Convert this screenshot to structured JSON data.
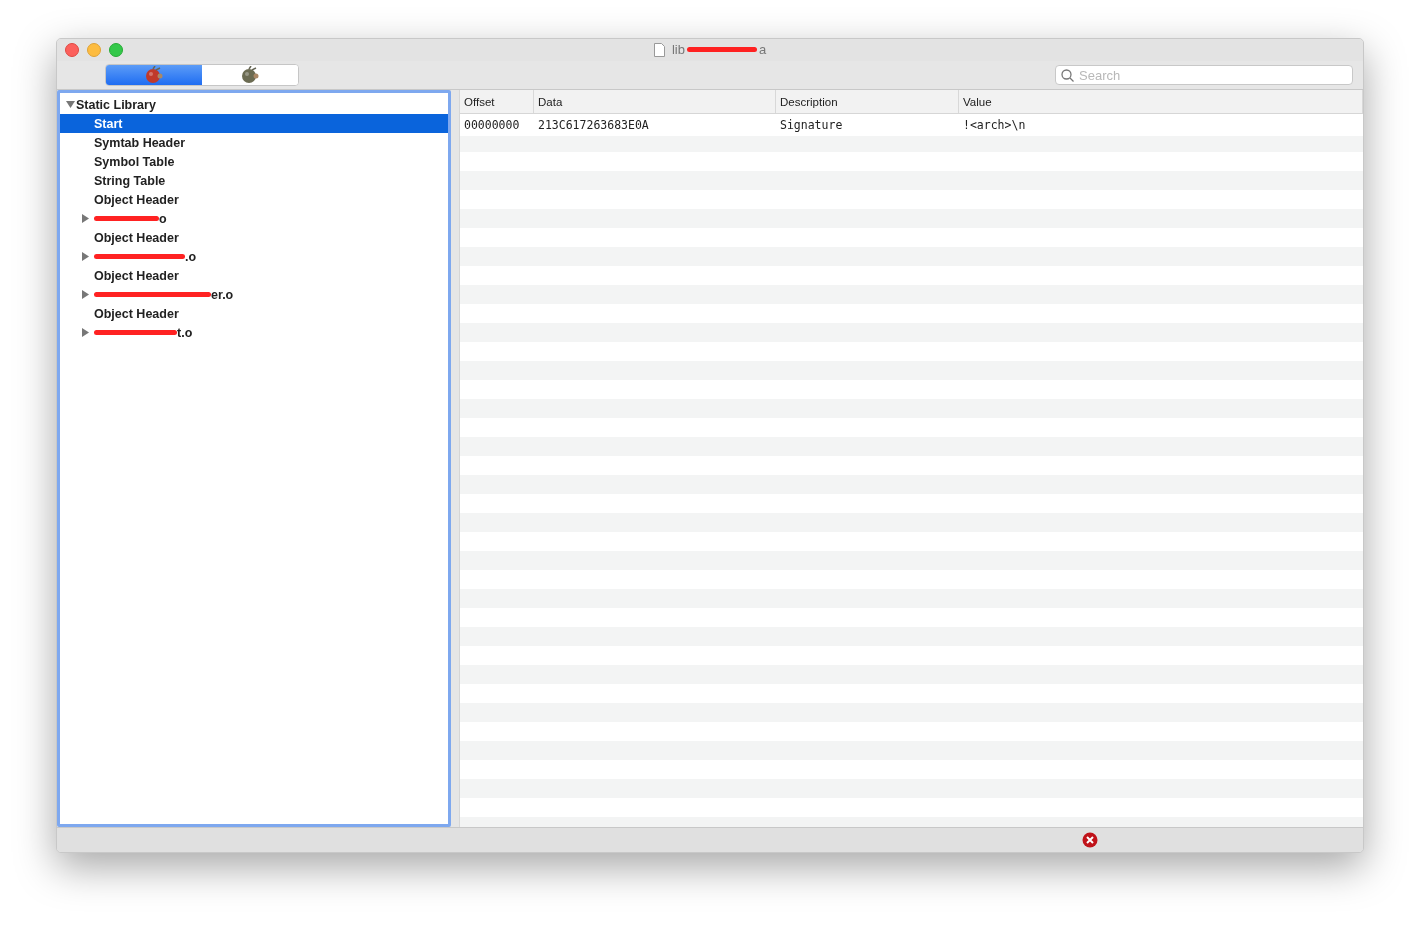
{
  "window": {
    "title_before": "lib",
    "title_after": "a",
    "title_redacted": true
  },
  "view_switch": [
    {
      "selected": true
    },
    {
      "selected": false
    }
  ],
  "search": {
    "placeholder": "Search"
  },
  "tree": [
    {
      "label": "Static Library",
      "expanded": true,
      "selected": false,
      "children": [
        {
          "label": "Start",
          "selected": true,
          "redacted": false
        },
        {
          "label": "Symtab Header",
          "selected": false,
          "redacted": false
        },
        {
          "label": "Symbol Table",
          "selected": false,
          "redacted": false
        },
        {
          "label": "String Table",
          "selected": false,
          "redacted": false
        },
        {
          "label": "Object Header",
          "selected": false,
          "redacted": false
        },
        {
          "label": "o",
          "selected": false,
          "redacted": true,
          "expandable": true
        },
        {
          "label": "Object Header",
          "selected": false,
          "redacted": false
        },
        {
          "label": ".o",
          "selected": false,
          "redacted": true,
          "expandable": true
        },
        {
          "label": "Object Header",
          "selected": false,
          "redacted": false
        },
        {
          "label": "er.o",
          "selected": false,
          "redacted": true,
          "expandable": true
        },
        {
          "label": "Object Header",
          "selected": false,
          "redacted": false
        },
        {
          "label": "t.o",
          "selected": false,
          "redacted": true,
          "expandable": true
        }
      ]
    }
  ],
  "table": {
    "columns": [
      "Offset",
      "Data",
      "Description",
      "Value"
    ],
    "rows": [
      [
        "00000000",
        "213C617263683E0A",
        "Signature",
        "!<arch>\\n"
      ]
    ]
  },
  "status_bar": {
    "error": true
  }
}
